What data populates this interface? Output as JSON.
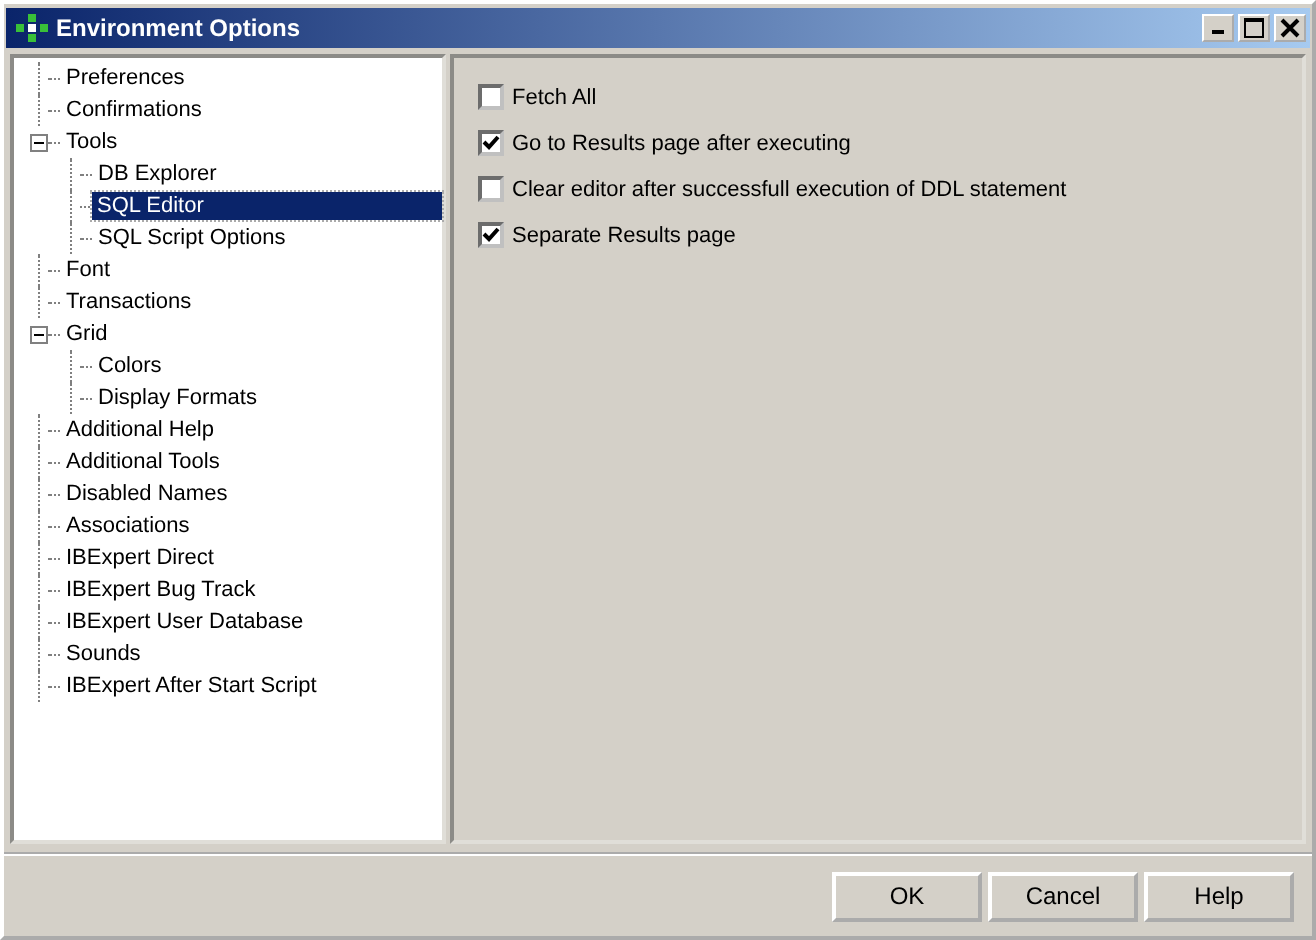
{
  "window": {
    "title": "Environment Options"
  },
  "tree": [
    {
      "label": "Preferences",
      "selected": false
    },
    {
      "label": "Confirmations",
      "selected": false
    },
    {
      "label": "Tools",
      "selected": false,
      "expanded": true,
      "children": [
        {
          "label": "DB Explorer",
          "selected": false
        },
        {
          "label": "SQL Editor",
          "selected": true
        },
        {
          "label": "SQL Script Options",
          "selected": false
        }
      ]
    },
    {
      "label": "Font",
      "selected": false
    },
    {
      "label": "Transactions",
      "selected": false
    },
    {
      "label": "Grid",
      "selected": false,
      "expanded": true,
      "children": [
        {
          "label": "Colors",
          "selected": false
        },
        {
          "label": "Display Formats",
          "selected": false
        }
      ]
    },
    {
      "label": "Additional Help",
      "selected": false
    },
    {
      "label": "Additional Tools",
      "selected": false
    },
    {
      "label": "Disabled Names",
      "selected": false
    },
    {
      "label": "Associations",
      "selected": false
    },
    {
      "label": "IBExpert Direct",
      "selected": false
    },
    {
      "label": "IBExpert Bug Track",
      "selected": false
    },
    {
      "label": "IBExpert User Database",
      "selected": false
    },
    {
      "label": "Sounds",
      "selected": false
    },
    {
      "label": "IBExpert After Start Script",
      "selected": false
    }
  ],
  "options": [
    {
      "label": "Fetch All",
      "checked": false
    },
    {
      "label": "Go to Results page after executing",
      "checked": true
    },
    {
      "label": "Clear editor after successfull execution of DDL statement",
      "checked": false
    },
    {
      "label": "Separate Results page",
      "checked": true
    }
  ],
  "buttons": [
    "OK",
    "Cancel",
    "Help"
  ]
}
